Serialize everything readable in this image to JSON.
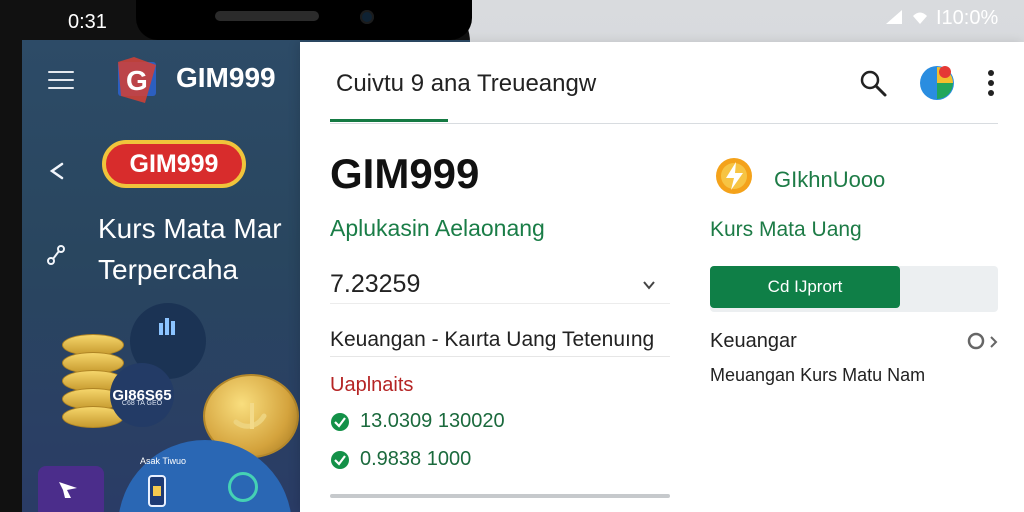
{
  "status_bar": {
    "time": "0:31",
    "right_text": "I10:0%"
  },
  "phone": {
    "brand_small": "GIM999",
    "brand_pill": "GIM999",
    "hero_lines": [
      "Kurs Mata Mar",
      "Terpercaha"
    ],
    "bubble_value": "GI86S65",
    "bubble_mini": "C68 TA GEO",
    "device_label": "Asak Tiwuo",
    "icons": {
      "menu": "menu-icon",
      "back": "back-icon",
      "share": "share-icon",
      "logo": "gim-logo-icon",
      "coin": "coin-icon",
      "device": "device-icon",
      "purple": "flag-icon",
      "dot": "circle-icon"
    }
  },
  "app": {
    "title": "Cuivtu 9 ana Treueangw",
    "brand_title": "GIM999",
    "subtitle": "Aplukasin Aelaonang",
    "selected_value": "7.23259",
    "description": "Keuangan - Kaırta Uang Tetenuıng",
    "updates_label": "Uaplnaits",
    "status_items": [
      {
        "text": "13.0309 130020",
        "icon": "check-circle-icon"
      },
      {
        "text": "0.9838 1000",
        "icon": "check-circle-icon"
      }
    ],
    "right_panel": {
      "brand": "GIkhnUooo",
      "subtitle": "Kurs Mata Uang",
      "button": "Cd IJprort",
      "category": "Keuangar",
      "meta": "Meuangan Kurs Matu Nam"
    },
    "icons": {
      "search": "search-icon",
      "profile": "profile-icon",
      "more": "more-vertical-icon",
      "dropdown": "chevron-down-icon",
      "radio": "radio-button-icon",
      "arrow": "chevron-right-icon",
      "right_logo": "lightning-coin-icon"
    },
    "colors": {
      "accent": "#157a43",
      "alert": "#b52424",
      "phone_bg": "#2d4b67"
    }
  }
}
